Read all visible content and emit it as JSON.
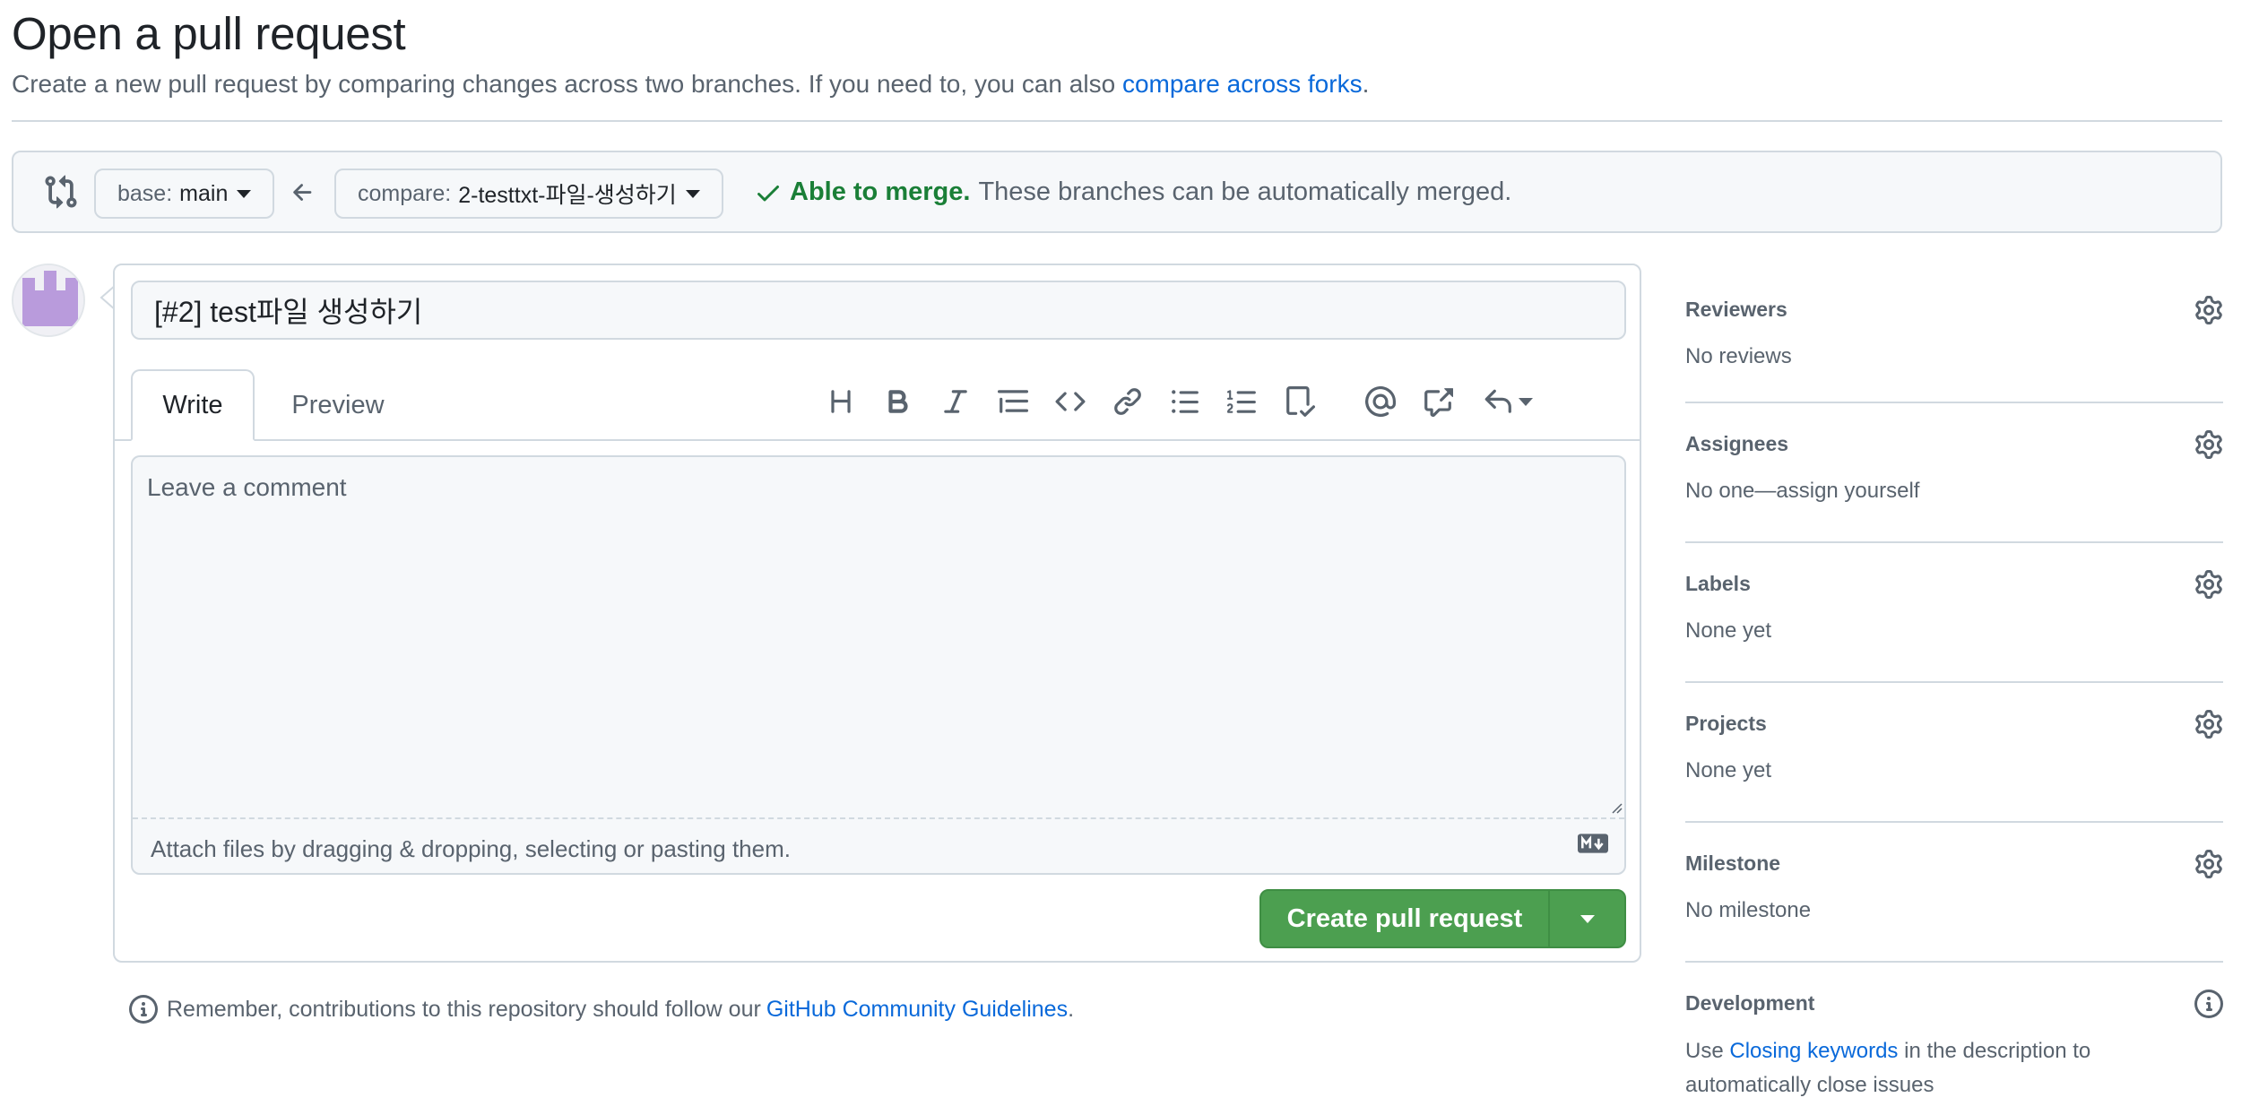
{
  "header": {
    "title": "Open a pull request",
    "subtitle": "Create a new pull request by comparing changes across two branches. If you need to, you can also",
    "subtitle_link": "compare across forks",
    "subtitle_end": "."
  },
  "compare": {
    "base_label": "base:",
    "base_branch": "main",
    "compare_label": "compare:",
    "compare_branch": "2-testtxt-파일-생성하기",
    "merge_status": "Able to merge.",
    "merge_description": "These branches can be automatically merged."
  },
  "form": {
    "title_value": "[#2] test파일 생성하기",
    "tabs": {
      "write": "Write",
      "preview": "Preview"
    },
    "comment_placeholder": "Leave a comment",
    "attach_text": "Attach files by dragging & dropping, selecting or pasting them.",
    "create_button": "Create pull request"
  },
  "reminder": {
    "text": "Remember, contributions to this repository should follow our",
    "link": "GitHub Community Guidelines",
    "end": "."
  },
  "sidebar": {
    "reviewers": {
      "title": "Reviewers",
      "value": "No reviews"
    },
    "assignees": {
      "title": "Assignees",
      "value": "No one—assign yourself"
    },
    "labels": {
      "title": "Labels",
      "value": "None yet"
    },
    "projects": {
      "title": "Projects",
      "value": "None yet"
    },
    "milestone": {
      "title": "Milestone",
      "value": "No milestone"
    },
    "development": {
      "title": "Development",
      "value_pre": "Use",
      "value_link": "Closing keywords",
      "value_post": "in the description to automatically close issues"
    }
  },
  "colors": {
    "accent_link": "#0969da",
    "success_green": "#1a7f37",
    "button_green": "#4c9f50",
    "avatar_purple": "#b99bdc"
  },
  "icons": {
    "compare": "git-compare-icon",
    "arrow": "arrow-left-icon",
    "check": "check-icon",
    "toolbar": [
      "heading-icon",
      "bold-icon",
      "italic-icon",
      "quote-icon",
      "code-icon",
      "link-icon",
      "unordered-list-icon",
      "ordered-list-icon",
      "tasklist-icon",
      "mention-icon",
      "cross-reference-icon",
      "reply-icon"
    ]
  }
}
